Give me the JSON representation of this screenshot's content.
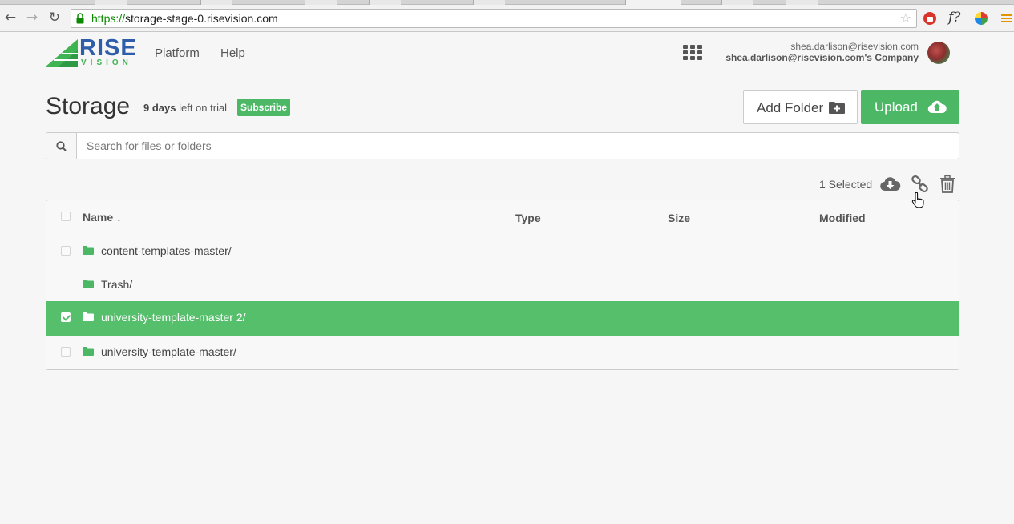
{
  "browser": {
    "url_scheme": "https://",
    "url_host": "storage-stage-0.risevision.com"
  },
  "logo": {
    "word1": "RISE",
    "word2": "VISION"
  },
  "nav": {
    "platform": "Platform",
    "help": "Help"
  },
  "user": {
    "email": "shea.darlison@risevision.com",
    "company": "shea.darlison@risevision.com's Company"
  },
  "page": {
    "title": "Storage",
    "trial_days": "9 days",
    "trial_suffix": " left on trial",
    "subscribe_label": "Subscribe",
    "add_folder_label": "Add Folder",
    "upload_label": "Upload"
  },
  "search": {
    "placeholder": "Search for files or folders"
  },
  "selection": {
    "count_label": "1 Selected"
  },
  "table": {
    "columns": {
      "name": "Name",
      "sort_arrow": "↓",
      "type": "Type",
      "size": "Size",
      "modified": "Modified"
    },
    "rows": [
      {
        "name": "content-templates-master/",
        "checked": false,
        "has_checkbox": true
      },
      {
        "name": "Trash/",
        "checked": false,
        "has_checkbox": false
      },
      {
        "name": "university-template-master 2/",
        "checked": true,
        "has_checkbox": true
      },
      {
        "name": "university-template-master/",
        "checked": false,
        "has_checkbox": true
      }
    ]
  },
  "colors": {
    "brand_green": "#4cb866",
    "selected_row": "#56bf6c",
    "brand_blue": "#2f5da9"
  }
}
